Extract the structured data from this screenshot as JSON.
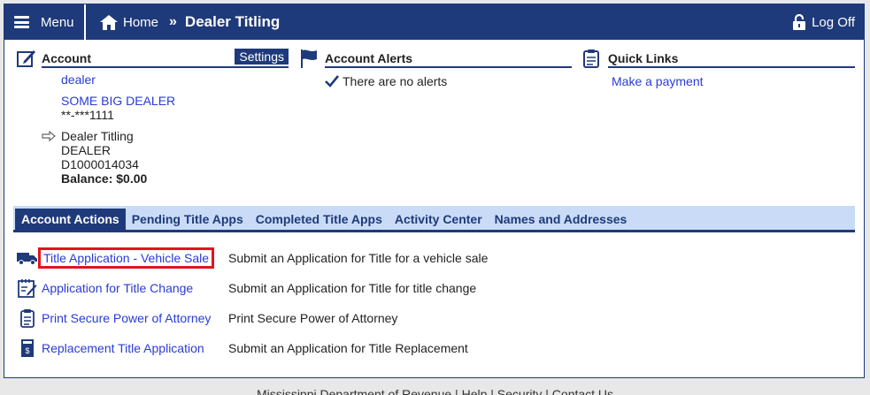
{
  "header": {
    "menu_label": "Menu",
    "home_label": "Home",
    "separator": "»",
    "current_page": "Dealer Titling",
    "logoff_label": "Log Off"
  },
  "account": {
    "title": "Account",
    "settings_label": "Settings",
    "user_link": "dealer",
    "dealer_name": "SOME BIG DEALER",
    "masked_id": "**-***1111",
    "service_name": "Dealer Titling",
    "service_type": "DEALER",
    "service_id": "D1000014034",
    "balance": "Balance: $0.00"
  },
  "alerts": {
    "title": "Account Alerts",
    "message": "There are no alerts"
  },
  "quick_links": {
    "title": "Quick Links",
    "items": [
      "Make a payment"
    ]
  },
  "tabs": [
    {
      "label": "Account Actions",
      "active": true
    },
    {
      "label": "Pending Title Apps",
      "active": false
    },
    {
      "label": "Completed Title Apps",
      "active": false
    },
    {
      "label": "Activity Center",
      "active": false
    },
    {
      "label": "Names and Addresses",
      "active": false
    }
  ],
  "actions": [
    {
      "icon": "truck-icon",
      "label": "Title Application - Vehicle Sale",
      "description": "Submit an Application for Title for a vehicle sale",
      "highlighted": true
    },
    {
      "icon": "edit-calendar-icon",
      "label": "Application for Title Change",
      "description": "Submit an Application for Title for title change",
      "highlighted": false
    },
    {
      "icon": "clipboard-icon",
      "label": "Print Secure Power of Attorney",
      "description": "Print Secure Power of Attorney",
      "highlighted": false
    },
    {
      "icon": "certificate-icon",
      "label": "Replacement Title Application",
      "description": "Submit an Application for Title Replacement",
      "highlighted": false
    }
  ],
  "footer": {
    "links": [
      "Mississippi Department of Revenue",
      "Help",
      "Security",
      "Contact Us"
    ],
    "separator": " | "
  },
  "colors": {
    "brand": "#1f3a7a",
    "link": "#2a3bd6",
    "tab_bg": "#c9dbf7",
    "highlight": "#e0141e"
  }
}
